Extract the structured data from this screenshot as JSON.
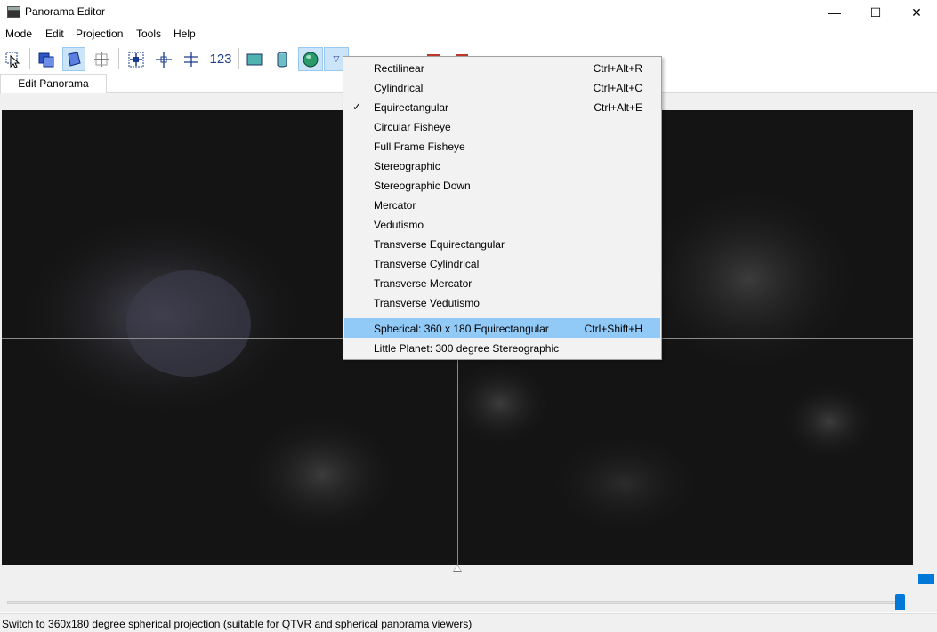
{
  "window": {
    "title": "Panorama Editor",
    "minimize": "—",
    "maximize": "☐",
    "close": "✕"
  },
  "menu": [
    "Mode",
    "Edit",
    "Projection",
    "Tools",
    "Help"
  ],
  "toolbar": {
    "num_label": "123"
  },
  "tab": {
    "label": "Edit Panorama"
  },
  "projection_menu": {
    "items": [
      {
        "label": "Rectilinear",
        "shortcut": "Ctrl+Alt+R",
        "checked": false
      },
      {
        "label": "Cylindrical",
        "shortcut": "Ctrl+Alt+C",
        "checked": false
      },
      {
        "label": "Equirectangular",
        "shortcut": "Ctrl+Alt+E",
        "checked": true
      },
      {
        "label": "Circular Fisheye",
        "shortcut": "",
        "checked": false
      },
      {
        "label": "Full Frame Fisheye",
        "shortcut": "",
        "checked": false
      },
      {
        "label": "Stereographic",
        "shortcut": "",
        "checked": false
      },
      {
        "label": "Stereographic Down",
        "shortcut": "",
        "checked": false
      },
      {
        "label": "Mercator",
        "shortcut": "",
        "checked": false
      },
      {
        "label": "Vedutismo",
        "shortcut": "",
        "checked": false
      },
      {
        "label": "Transverse Equirectangular",
        "shortcut": "",
        "checked": false
      },
      {
        "label": "Transverse Cylindrical",
        "shortcut": "",
        "checked": false
      },
      {
        "label": "Transverse Mercator",
        "shortcut": "",
        "checked": false
      },
      {
        "label": "Transverse Vedutismo",
        "shortcut": "",
        "checked": false
      }
    ],
    "presets": [
      {
        "label": "Spherical: 360 x 180 Equirectangular",
        "shortcut": "Ctrl+Shift+H",
        "highlighted": true
      },
      {
        "label": "Little Planet: 300 degree Stereographic",
        "shortcut": "",
        "highlighted": false
      }
    ],
    "check_glyph": "✓"
  },
  "status": {
    "text": "Switch to 360x180 degree spherical projection (suitable for QTVR and spherical panorama viewers)"
  },
  "colors": {
    "accent": "#0078d7",
    "highlight": "#91c9f7",
    "annotation_green": "#5fd14a",
    "preview_bg": "#141414"
  }
}
